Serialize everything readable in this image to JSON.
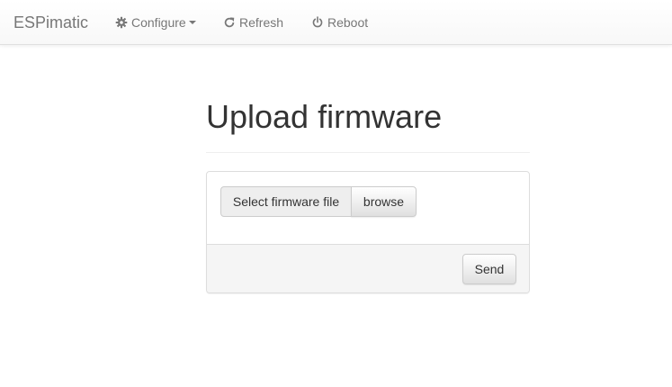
{
  "navbar": {
    "brand": "ESPimatic",
    "items": [
      {
        "label": "Configure",
        "icon": "gear-icon",
        "dropdown": true
      },
      {
        "label": "Refresh",
        "icon": "refresh-icon"
      },
      {
        "label": "Reboot",
        "icon": "power-icon"
      }
    ]
  },
  "page": {
    "title": "Upload firmware"
  },
  "upload_form": {
    "file_label": "Select firmware file",
    "browse_label": "browse",
    "send_label": "Send"
  },
  "colors": {
    "nav_text": "#777777",
    "panel_border": "#dddddd",
    "footer_bg": "#f5f5f5"
  }
}
